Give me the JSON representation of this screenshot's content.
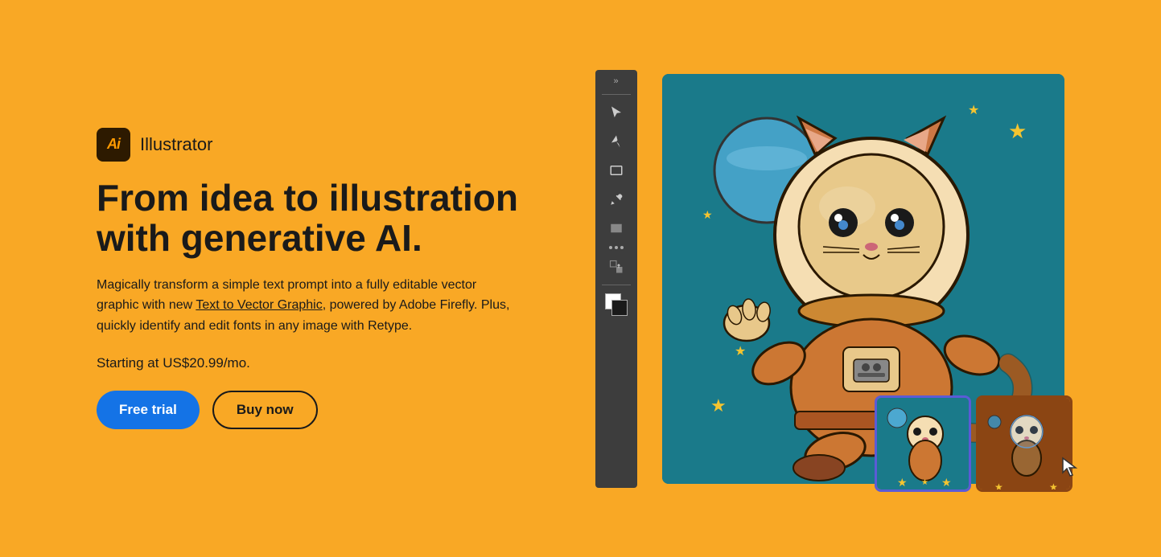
{
  "brand": {
    "logo_text": "Ai",
    "name": "Illustrator"
  },
  "headline": {
    "line1": "From idea to illustration",
    "line2": "with generative AI."
  },
  "description": {
    "text_before_link": "Magically transform a simple text prompt into a fully editable vector graphic with new ",
    "link_text": "Text to Vector Graphic",
    "text_after_link": ", powered by Adobe Firefly. Plus, quickly identify and edit fonts in any image with Retype."
  },
  "pricing": {
    "label": "Starting at US$20.99/mo."
  },
  "cta": {
    "free_trial_label": "Free trial",
    "buy_now_label": "Buy now"
  },
  "toolbar": {
    "expand_icon": "»"
  },
  "colors": {
    "background": "#F9A825",
    "button_primary": "#1473E6",
    "illustration_bg": "#1a7a8a"
  }
}
